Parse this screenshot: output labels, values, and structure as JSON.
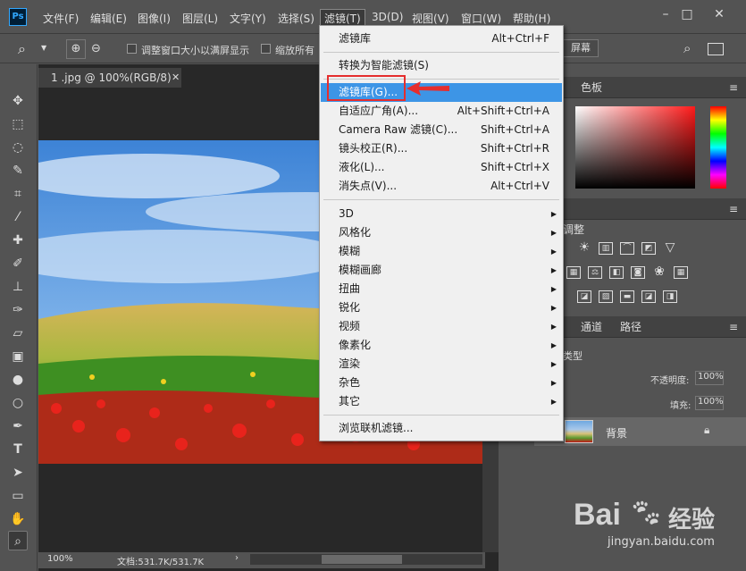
{
  "app": {
    "logo": "Ps"
  },
  "menubar": {
    "items": [
      "文件(F)",
      "编辑(E)",
      "图像(I)",
      "图层(L)",
      "文字(Y)",
      "选择(S)",
      "滤镜(T)",
      "3D(D)",
      "视图(V)",
      "窗口(W)",
      "帮助(H)"
    ]
  },
  "options": {
    "resize_label": "调整窗口大小以满屏显示",
    "zoom_all_label": "缩放所有",
    "fullscreen": "屏幕"
  },
  "document": {
    "tab_title": "1 .jpg @ 100%(RGB/8)",
    "zoom": "100%",
    "doc_size": "文档:531.7K/531.7K"
  },
  "panels": {
    "color_tab": "色板",
    "adjust_label": "调整",
    "channels_tab": "通道",
    "paths_tab": "路径",
    "kind_label": "类型",
    "opacity_label": "不透明度:",
    "opacity_value": "100%",
    "fill_label": "填充:",
    "fill_value": "100%",
    "layer_name": "背景"
  },
  "dropdown": {
    "last_filter": {
      "label": "滤镜库",
      "shortcut": "Alt+Ctrl+F"
    },
    "smart": "转换为智能滤镜(S)",
    "gallery": "滤镜库(G)...",
    "items": [
      {
        "label": "自适应广角(A)...",
        "shortcut": "Alt+Shift+Ctrl+A"
      },
      {
        "label": "Camera Raw 滤镜(C)...",
        "shortcut": "Shift+Ctrl+A"
      },
      {
        "label": "镜头校正(R)...",
        "shortcut": "Shift+Ctrl+R"
      },
      {
        "label": "液化(L)...",
        "shortcut": "Shift+Ctrl+X"
      },
      {
        "label": "消失点(V)...",
        "shortcut": "Alt+Ctrl+V"
      }
    ],
    "submenus": [
      "3D",
      "风格化",
      "模糊",
      "模糊画廊",
      "扭曲",
      "锐化",
      "视频",
      "像素化",
      "渲染",
      "杂色",
      "其它"
    ],
    "browse": "浏览联机滤镜..."
  },
  "watermark": {
    "brand_left": "Bai",
    "brand_right": "经验",
    "url": "jingyan.baidu.com"
  },
  "colors": {
    "highlight": "#3d95e6",
    "callout": "#e52e2e",
    "menubar": "#535353"
  }
}
